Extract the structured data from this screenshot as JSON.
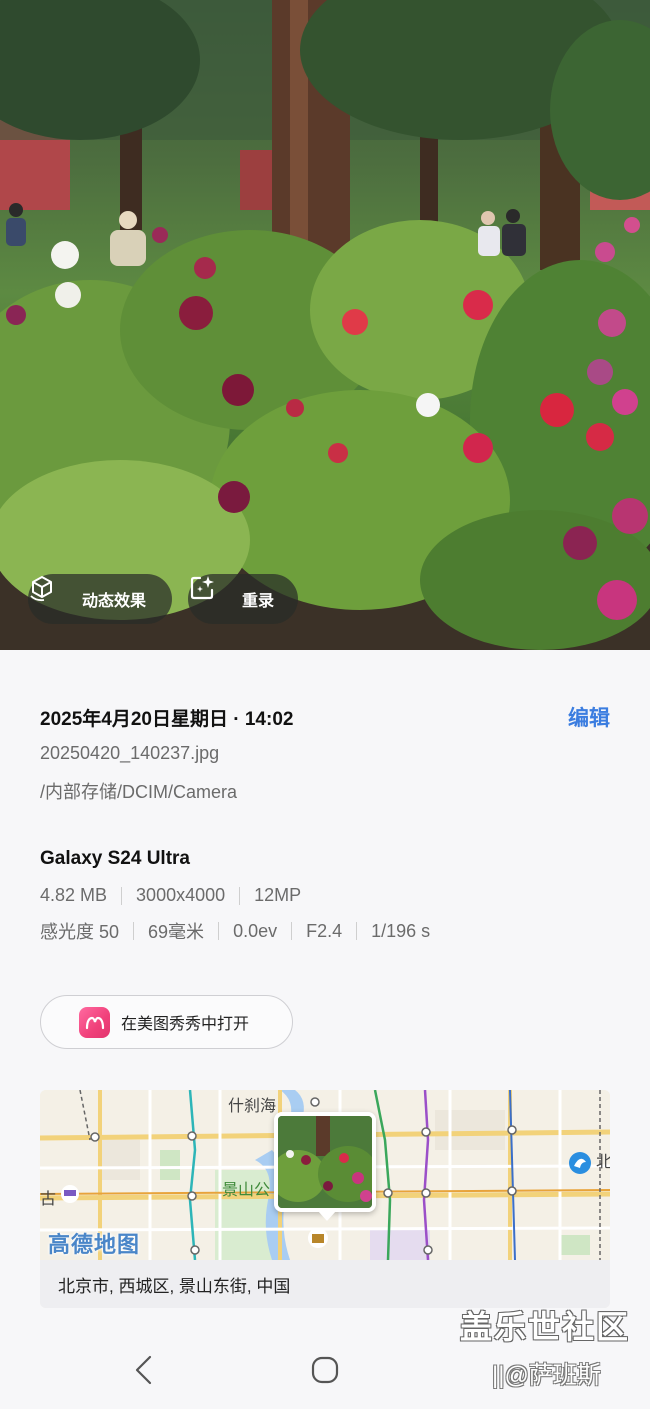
{
  "photo": {
    "motion_effect_label": "动态效果",
    "rerecord_label": "重录"
  },
  "details": {
    "date_time": "2025年4月20日星期日 · 14:02",
    "edit_label": "编辑",
    "filename": "20250420_140237.jpg",
    "path": "/内部存储/DCIM/Camera",
    "device": "Galaxy S24 Ultra",
    "file_info": [
      "4.82 MB",
      "3000x4000",
      "12MP"
    ],
    "exif": [
      "感光度 50",
      "69毫米",
      "0.0ev",
      "F2.4",
      "1/196 s"
    ]
  },
  "open_with": {
    "label": "在美图秀秀中打开",
    "icon": "meitu-icon"
  },
  "map": {
    "labels": {
      "shichahai": "什刹海",
      "jingshan": "景山公",
      "left_partial": "古",
      "right_partial": "北"
    },
    "brand": "高德地图",
    "address": "北京市, 西城区, 景山东街, 中国"
  },
  "navbar": {
    "back_icon": "back-chevron-icon",
    "home_icon": "home-circle-icon"
  },
  "watermark": {
    "line1": "盖乐世社区",
    "line2": "||@萨班斯"
  },
  "colors": {
    "accent": "#3b7de0",
    "meitu_pink": "#f0407a",
    "background": "#f7f7f9"
  }
}
